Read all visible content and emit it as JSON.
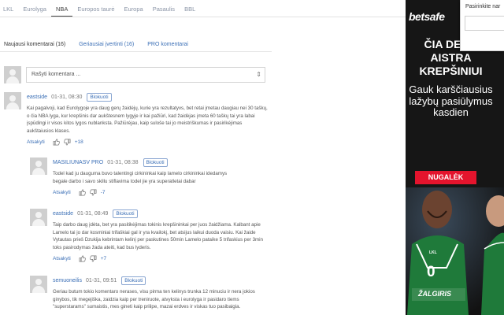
{
  "nav": [
    "LKL",
    "Eurolyga",
    "NBA",
    "Europos taurė",
    "Europa",
    "Pasaulis",
    "BBL"
  ],
  "nav_active": "NBA",
  "tabs": [
    "Naujausi komentarai (16)",
    "Geriausiai įvertinti (16)",
    "PRO komentarai"
  ],
  "write_placeholder": "Rašyti komentara ...",
  "block_label": "Blokuoti",
  "reply_label": "Atsakyti",
  "comments": [
    {
      "author": "eastside",
      "date": "01-31, 08:30",
      "text": "Kai pagalvoji, kad Eurolygoje yra daug gerų žaidėjų, kurie yra rezultatyvs, bet retai įmetau daugiau nei 30 taškų, o čia NBA lyga, kur krepšinis dar aukštesnem lygyje ir kai pažiūri, kad žaidėjas įmeta 60 taškų tai yra labai įspūdingi ir visos kitos lygos nublanksta. Pažiūrėjau, kaip suloše tai jo meistriškumas ir pasirikėjimas aukštaiusios klases.",
      "score": "+18"
    },
    {
      "author": "MASILIUNASV PRO",
      "date": "01-31, 08:38",
      "text": "Todel kad ju dauguma buvo talentingi cirkininkai kaip lamelo cirkininkai idedamys begale darbo i savo skillu stiflavima todel jie yra superatletai dabar",
      "score": "-7"
    },
    {
      "author": "eastside",
      "date": "01-31, 08:49",
      "text": "Taip darbo daug įdėta, bet yra pasitikėjimas tokinis krepšininkai per juos žaidžiama. Kalbant apie Lamelo tai jo dar kosminiai trifaškiai gal ir yra kvailokį, bet atsijus laikui duoda vaisiu. Kai žaide Vytautas prieš Dzukija kebrintam kelinį per paskutines 50min Lamelo pataike 5 trifaskius per 3min toks pasirodymas žada ateiti, kad bus lyderis.",
      "score": "+7"
    },
    {
      "author": "semuoneilis",
      "date": "01-31, 09:51",
      "text": "Geriau butum tokio komentaro nerases, visu pirma ten kelinys trunka 12 minuciu ir nera jokios ginybos, tik megejiška, zaidzia kaip per treniruote, atvyksta i eurolyga ir pasidaro tiems \"superstarams\" sumaistis, mes gineti kaip prilipe, mazai erdves ir viskas tuo pasibaigia."
    }
  ],
  "ad": {
    "logo": "betsafe",
    "headline": "ČIA DEGA AISTRA KREPŠINIUI",
    "subheadline": "Gauk karščiausius lažybų pasiūlymus kasdien",
    "button": "NUGALĖK",
    "lkl": "LKL",
    "number": "0",
    "team": "ŽALGIRIS"
  },
  "search_label": "Pasirinkite nar",
  "colors": {
    "link": "#3b6fb6",
    "ad_background": "#161616",
    "ad_button": "#e4142d",
    "jersey_green": "#1f7a3a"
  }
}
